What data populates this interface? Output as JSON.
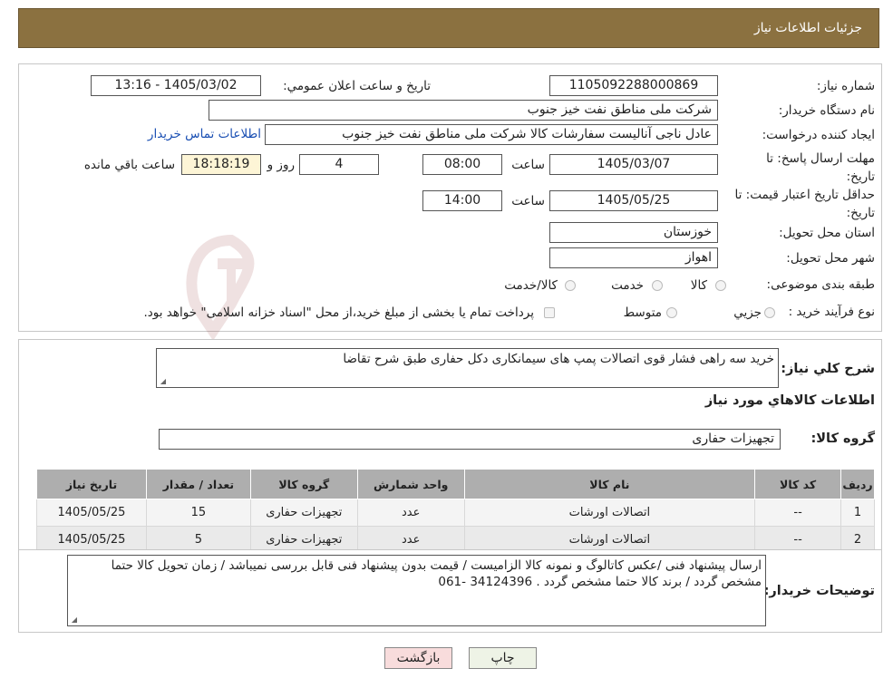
{
  "header": {
    "title": "جزئيات اطلاعات نياز"
  },
  "form": {
    "need_number_label": "شماره نياز:",
    "need_number": "1105092288000869",
    "announce_label": "تاريخ و ساعت اعلان عمومي:",
    "announce_value": "1405/03/02 - 13:16",
    "buyer_org_label": "نام دستگاه خريدار:",
    "buyer_org": "شرکت ملی مناطق نفت خیز جنوب",
    "creator_label": "ايجاد کننده درخواست:",
    "creator": "عادل  ناجی آنالیست سفارشات کالا  شرکت ملی مناطق نفت خیز جنوب",
    "buyer_contact_link": "اطلاعات تماس خريدار",
    "reply_deadline_label": "مهلت ارسال پاسخ: تا تاريخ:",
    "reply_date": "1405/03/07",
    "time_label": "ساعت",
    "reply_time": "08:00",
    "days_value": "4",
    "days_label": "روز و",
    "remaining_time": "18:18:19",
    "remaining_label": "ساعت باقي مانده",
    "price_validity_label": "حداقل تاريخ اعتبار قيمت: تا تاريخ:",
    "price_date": "1405/05/25",
    "price_time": "14:00",
    "province_label": "استان محل تحويل:",
    "province": "خوزستان",
    "city_label": "شهر محل تحويل:",
    "city": "اهواز",
    "category_label": "طبقه بندی موضوعی:",
    "category_options": [
      "کالا",
      "خدمت",
      "کالا/خدمت"
    ],
    "process_label": "نوع فرآيند خريد :",
    "process_options": [
      "جزيي",
      "متوسط"
    ],
    "process_note": "پرداخت تمام یا بخشی از مبلغ خرید،از محل \"اسناد خزانه اسلامی\" خواهد بود."
  },
  "description": {
    "label": "شرح کلي نياز:",
    "value": "خرید سه راهی فشار قوی اتصالات پمپ های سیمانکاری دکل حفاری طبق شرح تقاضا"
  },
  "goods": {
    "section_title": "اطلاعات کالاهاي مورد نياز",
    "group_label": "گروه کالا:",
    "group_value": "تجهیزات حفاری",
    "columns": [
      "رديف",
      "کد کالا",
      "نام کالا",
      "واحد شمارش",
      "گروه کالا",
      "تعداد / مقدار",
      "تاريخ نياز"
    ],
    "rows": [
      [
        "1",
        "--",
        "اتصالات اورشات",
        "عدد",
        "تجهیزات حفاری",
        "15",
        "1405/05/25"
      ],
      [
        "2",
        "--",
        "اتصالات اورشات",
        "عدد",
        "تجهیزات حفاری",
        "5",
        "1405/05/25"
      ]
    ]
  },
  "buyer_notes": {
    "label": "توضيحات خريدار:",
    "value": "ارسال پیشنهاد فنی /عکس کاتالوگ و نمونه کالا الزامیست / قیمت بدون پیشنهاد فنی قابل بررسی نمیباشد / زمان تحویل کالا حتما مشخص گردد / برند کالا حتما مشخص گردد . 34124396 -061"
  },
  "buttons": {
    "print": "چاپ",
    "back": "بازگشت"
  },
  "colors": {
    "header": "#8b7140",
    "link": "#1a4fb3",
    "back_button": "#f8dcdc",
    "print_button": "#eef3e6"
  }
}
